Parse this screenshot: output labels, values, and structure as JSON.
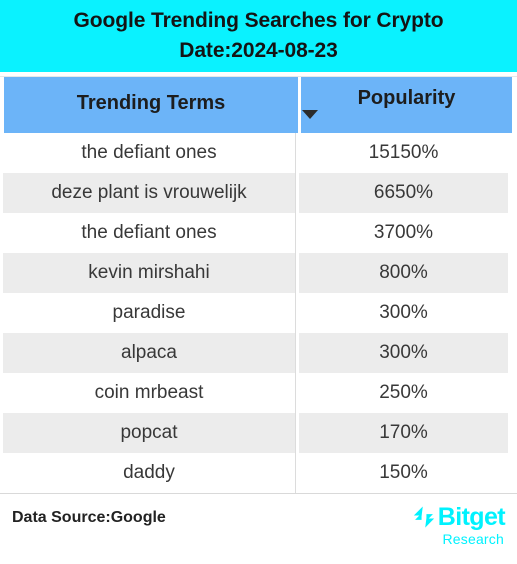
{
  "title": {
    "line1": "Google Trending Searches for Crypto",
    "line2": "Date:2024-08-23",
    "banner_color": "#0af2ff"
  },
  "table": {
    "header_color": "#6cb4f8",
    "alt_row_color": "#ececec",
    "columns": [
      {
        "label": "Trending Terms",
        "sorted": false
      },
      {
        "label": "Popularity",
        "sorted": true,
        "sort_direction": "desc",
        "sort_icon": "caret-down-icon"
      }
    ],
    "rows": [
      {
        "term": "the defiant ones",
        "popularity": "15150%"
      },
      {
        "term": "deze plant is vrouwelijk",
        "popularity": "6650%"
      },
      {
        "term": "the defiant ones",
        "popularity": "3700%"
      },
      {
        "term": "kevin mirshahi",
        "popularity": "800%"
      },
      {
        "term": "paradise",
        "popularity": "300%"
      },
      {
        "term": "alpaca",
        "popularity": "300%"
      },
      {
        "term": "coin mrbeast",
        "popularity": "250%"
      },
      {
        "term": "popcat",
        "popularity": "170%"
      },
      {
        "term": "daddy",
        "popularity": "150%"
      }
    ]
  },
  "footer": {
    "data_source": "Data Source:Google",
    "logo": {
      "mark_icon": "bitget-chevron-icon",
      "wordmark": "Bitget",
      "subtitle": "Research",
      "color": "#00f2fe"
    }
  },
  "chart_data": {
    "type": "table",
    "title": "Google Trending Searches for Crypto",
    "subtitle": "Date:2024-08-23",
    "columns": [
      "Trending Terms",
      "Popularity"
    ],
    "categories": [
      "the defiant ones",
      "deze plant is vrouwelijk",
      "the defiant ones",
      "kevin mirshahi",
      "paradise",
      "alpaca",
      "coin mrbeast",
      "popcat",
      "daddy"
    ],
    "values": [
      15150,
      6650,
      3700,
      800,
      300,
      300,
      250,
      170,
      150
    ],
    "value_unit": "%",
    "value_labels": [
      "15150%",
      "6650%",
      "3700%",
      "800%",
      "300%",
      "300%",
      "250%",
      "170%",
      "150%"
    ],
    "sorted_by": "Popularity",
    "sort_order": "descending",
    "xlabel": "Trending Terms",
    "ylabel": "Popularity",
    "source": "Data Source:Google"
  }
}
